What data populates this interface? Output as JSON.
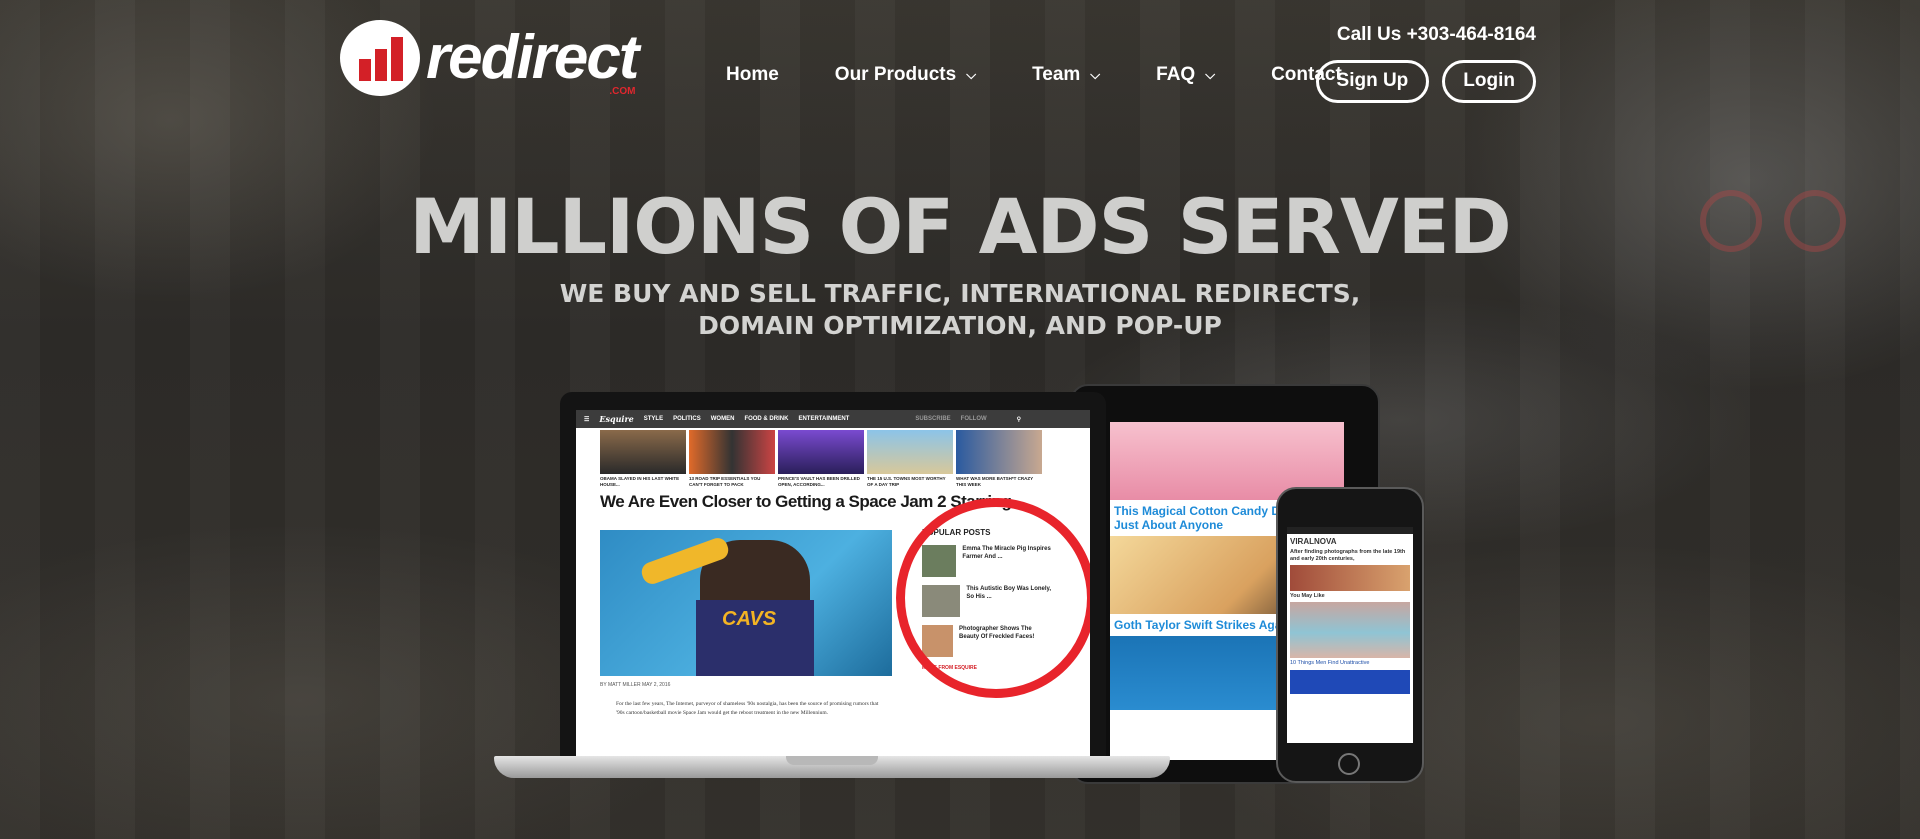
{
  "header": {
    "logo_text": "redirect",
    "logo_suffix": ".COM",
    "phone": "Call Us +303-464-8164",
    "nav": [
      {
        "label": "Home",
        "has_dropdown": false
      },
      {
        "label": "Our Products",
        "has_dropdown": true
      },
      {
        "label": "Team",
        "has_dropdown": true
      },
      {
        "label": "FAQ",
        "has_dropdown": true
      },
      {
        "label": "Contact",
        "has_dropdown": false
      }
    ],
    "signup_label": "Sign Up",
    "login_label": "Login"
  },
  "hero": {
    "headline": "MILLIONS OF ADS SERVED",
    "subline_1": "WE BUY AND SELL TRAFFIC, INTERNATIONAL REDIRECTS,",
    "subline_2": "DOMAIN OPTIMIZATION, AND POP-UP"
  },
  "laptop_site": {
    "brand": "Esquire",
    "nav": [
      "STYLE",
      "POLITICS",
      "WOMEN",
      "FOOD & DRINK",
      "ENTERTAINMENT",
      "SUBSCRIBE",
      "FOLLOW"
    ],
    "thumb_captions": [
      "OBAMA SLAYED IN HIS LAST WHITE HOUSE...",
      "13 ROAD TRIP ESSENTIALS YOU CAN'T FORGET TO PACK",
      "PRINCE'S VAULT HAS BEEN DRILLED OPEN, ACCORDING...",
      "THE 15 U.S. TOWNS MOST WORTHY OF A DAY TRIP",
      "WHAT WAS MORE BATSH*T CRAZY THIS WEEK"
    ],
    "article_title": "We Are Even Closer to Getting a Space Jam 2 Starring",
    "jersey": "CAVS",
    "byline": "BY MATT MILLER  MAY 2, 2016",
    "body": "For the last few years, The Internet, purveyor of shameless '90s nostalgia, has been the source of promising rumors that '90s cartoon/basketball movie Space Jam would get the reboot treatment in the new Millennium.",
    "popular_heading": "POPULAR POSTS",
    "popular": [
      "Emma The Miracle Pig Inspires Farmer And ...",
      "This Autistic Boy Was Lonely, So His ...",
      "Photographer Shows The Beauty Of Freckled Faces!"
    ],
    "more": "MORE FROM ESQUIRE"
  },
  "tablet_site": {
    "title_1": "This Magical Cotton Candy Dr... Shock Just About Anyone",
    "title_2": "Goth Taylor Swift Strikes Agai..."
  },
  "phone_site": {
    "logo": "VIRALNOVA",
    "text": "After finding photographs from the late 19th and early 20th centuries,",
    "may_like": "You May Like",
    "caption": "10 Things Men Find Unattractive"
  },
  "colors": {
    "accent_red": "#d32027",
    "headline": "#cfcfcd",
    "circle": "#e8242b"
  }
}
